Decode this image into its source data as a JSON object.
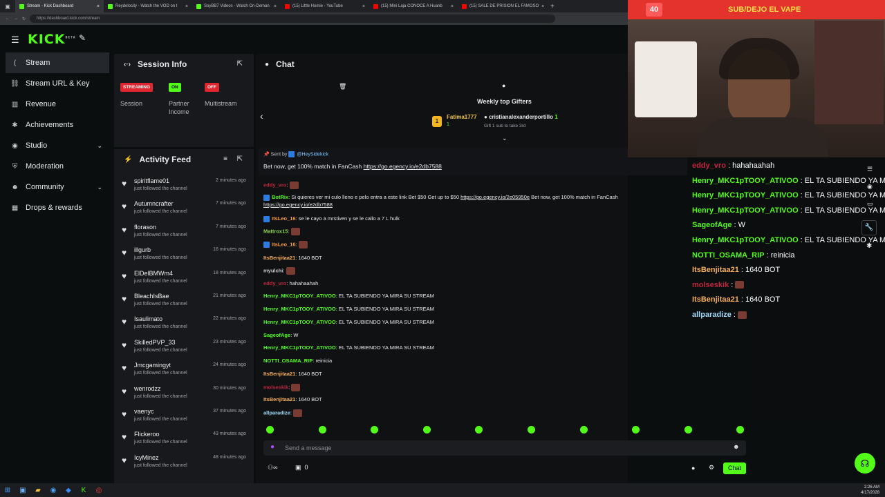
{
  "browser": {
    "tabs": [
      {
        "title": "Stream - Kick Dashboard",
        "color": "#53fc18"
      },
      {
        "title": "Reydelocity - Watch the VOD on t",
        "color": "#53fc18"
      },
      {
        "title": "SoyBB7 Videos - Watch On-Deman",
        "color": "#53fc18"
      },
      {
        "title": "(15) Little Homie - YouTube",
        "color": "#ff0000"
      },
      {
        "title": "(15) Mini Laja CONOCE A Huanb",
        "color": "#ff0000"
      },
      {
        "title": "(15) SALE DE PRISION EL FAMOSO",
        "color": "#ff0000"
      }
    ],
    "url": "https://dashboard.kick.com/stream"
  },
  "app": {
    "logo": "KICK",
    "logo_sup": "BETA"
  },
  "sidebar": {
    "items": [
      {
        "label": "Stream",
        "icon": "broadcast-icon"
      },
      {
        "label": "Stream URL & Key",
        "icon": "link-icon"
      },
      {
        "label": "Revenue",
        "icon": "chart-icon"
      },
      {
        "label": "Achievements",
        "icon": "star-icon"
      },
      {
        "label": "Studio",
        "icon": "camera-icon"
      },
      {
        "label": "Moderation",
        "icon": "shield-icon"
      },
      {
        "label": "Community",
        "icon": "users-icon"
      },
      {
        "label": "Drops & rewards",
        "icon": "gift-icon"
      }
    ]
  },
  "session": {
    "title": "Session Info",
    "cols": [
      {
        "badge": "STREAMING",
        "label": "Session",
        "color": "#e0252f"
      },
      {
        "badge": "ON",
        "label": "Partner Income",
        "color": "#53fc18"
      },
      {
        "badge": "OFF",
        "label": "Multistream",
        "color": "#e0252f"
      }
    ]
  },
  "activity": {
    "title": "Activity Feed",
    "items": [
      {
        "name": "spiritflame01",
        "sub": "just followed the channel",
        "time": "2 minutes ago"
      },
      {
        "name": "Autumncrafter",
        "sub": "just followed the channel",
        "time": "7 minutes ago"
      },
      {
        "name": "florason",
        "sub": "just followed the channel",
        "time": "7 minutes ago"
      },
      {
        "name": "illgurb",
        "sub": "just followed the channel",
        "time": "16 minutes ago"
      },
      {
        "name": "ElDelBMWm4",
        "sub": "just followed the channel",
        "time": "18 minutes ago"
      },
      {
        "name": "BleachIsBae",
        "sub": "just followed the channel",
        "time": "21 minutes ago"
      },
      {
        "name": "Isaulimato",
        "sub": "just followed the channel",
        "time": "22 minutes ago"
      },
      {
        "name": "SkilledPVP_33",
        "sub": "just followed the channel",
        "time": "23 minutes ago"
      },
      {
        "name": "Jmcgamingyt",
        "sub": "just followed the channel",
        "time": "24 minutes ago"
      },
      {
        "name": "wenrodzz",
        "sub": "just followed the channel",
        "time": "30 minutes ago"
      },
      {
        "name": "vaenyc",
        "sub": "just followed the channel",
        "time": "37 minutes ago"
      },
      {
        "name": "Flickeroo",
        "sub": "just followed the channel",
        "time": "43 minutes ago"
      },
      {
        "name": "IcyMinez",
        "sub": "just followed the channel",
        "time": "48 minutes ago"
      }
    ]
  },
  "chat": {
    "title": "Chat",
    "gifters_title": "Weekly top Gifters",
    "gifter1": "Fatima1777",
    "gifter1_count": "1",
    "gifter2": "cristianalexanderportillo",
    "gifter2_count": "1",
    "gift_note": "Gift 1 sub to take 3rd",
    "pinned_by": "Sent by",
    "pinned_user": "@HeySidekick",
    "pinned_text": "Bet now, get 100% match in FanCash",
    "pinned_link": "https://go.egency.io/e2db7588",
    "messages": [
      {
        "user": "eddy_vro",
        "color": "#c0263f",
        "text": "",
        "emote": true
      },
      {
        "user": "BotRix",
        "color": "#53fc18",
        "text": "Si quieres ver mi culo lleno e pelo entra a este link Bet $50 Get up to $50",
        "link": "https://go.egency.io/2e05950e",
        "tail": "Bet now, get 100% match in FanCash",
        "link2": "https://go.egency.io/e2db7588"
      },
      {
        "user": "ItsLeo_16",
        "color": "#f59a3c",
        "text": "se le cayo a mrstiven y se le callo a 7 L hulk"
      },
      {
        "user": "Mattrox15",
        "color": "#8fd14f",
        "text": "",
        "emote": true
      },
      {
        "user": "ItsLeo_16",
        "color": "#f59a3c",
        "text": "",
        "emote": true
      },
      {
        "user": "ItsBenjitaa21",
        "color": "#f5b060",
        "text": "1640 BOT"
      },
      {
        "user": "myulchi",
        "color": "#c9c9c9",
        "text": "",
        "emote": true
      },
      {
        "user": "eddy_vro",
        "color": "#c0263f",
        "text": "hahahaahah"
      },
      {
        "user": "Henry_MKC1pTOOY_ATIVOO",
        "color": "#53fc18",
        "text": "EL TA SUBIENDO YA MIRA SU STREAM"
      },
      {
        "user": "Henry_MKC1pTOOY_ATIVOO",
        "color": "#53fc18",
        "text": "EL TA SUBIENDO YA MIRA SU STREAM"
      },
      {
        "user": "Henry_MKC1pTOOY_ATIVOO",
        "color": "#53fc18",
        "text": "EL TA SUBIENDO YA MIRA SU STREAM"
      },
      {
        "user": "SageofAge",
        "color": "#53fc18",
        "text": "W"
      },
      {
        "user": "Henry_MKC1pTOOY_ATIVOO",
        "color": "#53fc18",
        "text": "EL TA SUBIENDO YA MIRA SU STREAM"
      },
      {
        "user": "NOTTI_OSAMA_RIP",
        "color": "#53fc18",
        "text": "reinicia"
      },
      {
        "user": "ItsBenjitaa21",
        "color": "#f5b060",
        "text": "1640 BOT"
      },
      {
        "user": "molseskik",
        "color": "#c0263f",
        "text": "",
        "emote": true
      },
      {
        "user": "ItsBenjitaa21",
        "color": "#f5b060",
        "text": "1640 BOT"
      },
      {
        "user": "allparadize",
        "color": "#9fd8f8",
        "text": "",
        "emote": true
      }
    ],
    "input_placeholder": "Send a message",
    "points": "0",
    "send_label": "Chat"
  },
  "overlay": {
    "follower_count": "40",
    "banner": "SUB/DEJO EL VAPE",
    "messages": [
      {
        "user": "eddy_vro",
        "color": "#c0263f",
        "text": "hahahaahah"
      },
      {
        "user": "Henry_MKC1pTOOY_ATIVOO",
        "color": "#53fc18",
        "text": "EL TA SUBIENDO YA MI"
      },
      {
        "user": "Henry_MKC1pTOOY_ATIVOO",
        "color": "#53fc18",
        "text": "EL TA SUBIENDO YA MI"
      },
      {
        "user": "Henry_MKC1pTOOY_ATIVOO",
        "color": "#53fc18",
        "text": "EL TA SUBIENDO YA MI"
      },
      {
        "user": "SageofAge",
        "color": "#53fc18",
        "text": "W"
      },
      {
        "user": "Henry_MKC1pTOOY_ATIVOO",
        "color": "#53fc18",
        "text": "EL TA SUBIENDO YA MI"
      },
      {
        "user": "NOTTI_OSAMA_RIP",
        "color": "#53fc18",
        "text": "reinicia"
      },
      {
        "user": "ItsBenjitaa21",
        "color": "#f5b060",
        "text": "1640 BOT"
      },
      {
        "user": "molseskik",
        "color": "#c0263f",
        "text": ""
      },
      {
        "user": "ItsBenjitaa21",
        "color": "#f5b060",
        "text": "1640 BOT"
      },
      {
        "user": "allparadize",
        "color": "#9fd8f8",
        "text": ""
      }
    ]
  },
  "taskbar": {
    "time": "2:26 AM",
    "date": "4/17/2028"
  },
  "colors": {
    "accent": "#53fc18",
    "danger": "#e0252f"
  }
}
